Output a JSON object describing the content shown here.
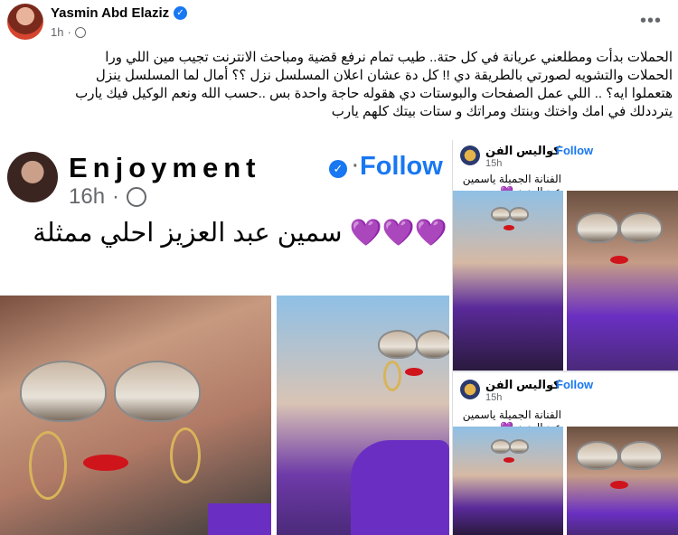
{
  "post": {
    "author": "Yasmin Abd Elaziz",
    "time": "1h",
    "text_lines": [
      "الحملات بدأت  ومطلعني عريانة في كل حتة.. طيب تمام نرفع قضية ومباحث الانترنت تجيب مين اللي ورا",
      "الحملات والتشويه لصورتي بالطريقة دي !! كل دة عشان اعلان المسلسل نزل ؟؟ أمال لما  المسلسل  ينزل",
      "هتعملوا ايه؟ .. اللي عمل الصفحات والبوستات دي هقوله حاجة واحدة بس ..حسب الله ونعم الوكيل فيك يارب",
      "يترددلك في امك واختك وبنتك ومراتك و ستات بيتك كلهم يارب"
    ]
  },
  "screenshot_main": {
    "page_name": "Enjoyment",
    "follow_label": "Follow",
    "time": "16h",
    "caption": "سمين عبد العزيز احلي ممثلة",
    "hearts": "💜💜💜"
  },
  "screenshot_top": {
    "page_name": "كواليس الفن",
    "follow_label": "Follow",
    "time": "15h",
    "caption": "الفنانة الجميلة ياسمين عبد العزيز 💜"
  },
  "screenshot_bottom": {
    "page_name": "كواليس الفن",
    "follow_label": "Follow",
    "time": "15h",
    "caption": "الفنانة الجميلة ياسمين عبد العزيز 💜"
  },
  "colors": {
    "accent": "#1877f2",
    "purple": "#6a2fc2"
  }
}
